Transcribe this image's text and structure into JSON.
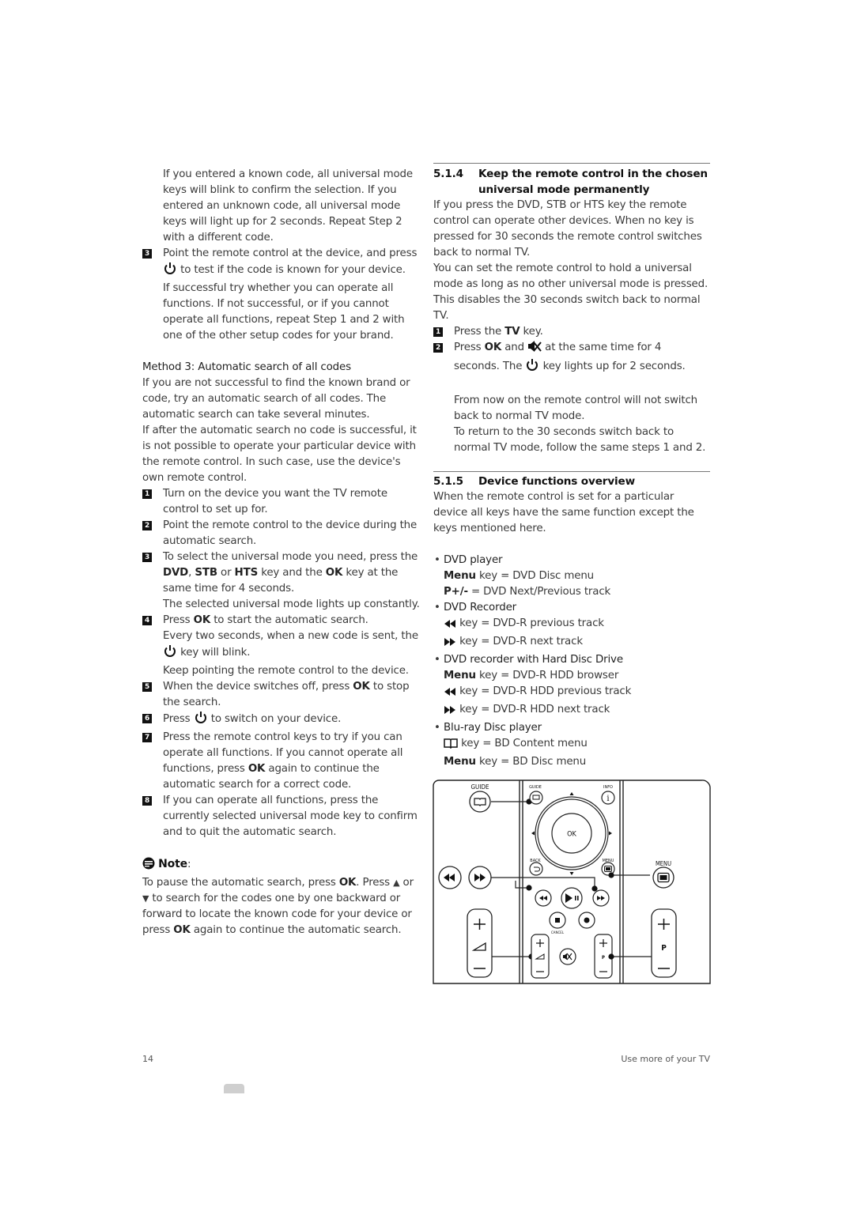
{
  "left": {
    "intro": "If you entered a known code, all universal mode keys will blink to confirm the selection. If you entered an unknown code, all universal mode keys will light up for 2 seconds. Repeat Step 2 with a different code.",
    "step3_num": "3",
    "step3_a": "Point the remote control at the device, and press",
    "step3_b": "to test if the code is known for your device.",
    "step3_c": "If successful try whether you can operate all functions. If not successful, or if you cannot operate all functions, repeat Step 1 and 2 with one of the other setup codes for your brand.",
    "method_title": "Method 3: Automatic search of all codes",
    "method_p1": "If you are not successful to find the known brand or code, try an automatic search of all codes. The automatic search can take several minutes.",
    "method_p2": "If after the automatic search no code is successful, it is not possible to operate your particular device with the remote control. In such case, use the device's own remote control.",
    "steps": [
      {
        "num": "1",
        "text": "Turn on the device you want the TV remote control to set up for."
      },
      {
        "num": "2",
        "text": "Point the remote control to the device during the automatic search."
      },
      {
        "num": "3",
        "t1": "To select the universal mode you need, press the",
        "k1": "DVD",
        "t2": ",",
        "k2": "STB",
        "t3": "or",
        "k3": "HTS",
        "t4": "key and the",
        "k4": "OK",
        "t5": "key at the same time for 4 seconds.",
        "t6": "The selected universal mode lights up constantly."
      },
      {
        "num": "4",
        "t1": "Press",
        "k1": "OK",
        "t2": "to start the automatic search.",
        "t3": "Every two seconds, when a new code is sent, the",
        "t4": "key will blink.",
        "t5": "Keep pointing the remote control to the device."
      },
      {
        "num": "5",
        "t1": "When the device switches off, press",
        "k1": "OK",
        "t2": "to stop the search."
      },
      {
        "num": "6",
        "t1": "Press",
        "t2": "to switch on your device."
      },
      {
        "num": "7",
        "t1": "Press the remote control keys to try if you can operate all functions. If you cannot operate all functions, press",
        "k1": "OK",
        "t2": "again to continue the automatic search for a correct code."
      },
      {
        "num": "8",
        "text": "If you can operate all functions, press the currently selected universal mode key to confirm and to quit the automatic search."
      }
    ],
    "note": {
      "title": "Note",
      "t1": "To pause the automatic search, press",
      "k1": "OK",
      "t2": ". Press",
      "t3": "or",
      "t4": "to search for the codes one by one backward or forward to locate the known code for your device or press",
      "k2": "OK",
      "t5": "again to continue the automatic search."
    }
  },
  "right": {
    "s514": {
      "num": "5.1.4",
      "title": "Keep the remote control in the chosen universal mode permanently",
      "p1": "If you press the DVD, STB or HTS key the remote control can operate other devices. When no key is pressed  for 30 seconds the remote control switches back to normal TV.",
      "p2": "You can set the remote control to hold a universal mode as long as no other universal mode is pressed. This disables the 30 seconds switch back to normal TV.",
      "step1": {
        "num": "1",
        "t1": "Press the",
        "k1": "TV",
        "t2": "key."
      },
      "step2": {
        "num": "2",
        "t1": "Press",
        "k1": "OK",
        "t2": "and",
        "t3": "at the same time for 4 seconds. The",
        "t4": "key lights up for 2 seconds."
      },
      "p3": "From now on the remote control will not switch back to normal TV mode.",
      "p4": "To return to the 30 seconds switch back to normal TV mode, follow the same steps 1 and 2."
    },
    "s515": {
      "num": "5.1.5",
      "title": "Device functions overview",
      "p1": "When the remote control is set for a particular device all keys have the same function except the keys mentioned here.",
      "devices": [
        {
          "name": "DVD player",
          "lines": [
            {
              "key": "Menu",
              "text": "key = DVD Disc menu"
            },
            {
              "key": "P+/-",
              "text": "= DVD Next/Previous track"
            }
          ]
        },
        {
          "name": "DVD Recorder",
          "lines": [
            {
              "icon": "rewind-icon",
              "text": "key = DVD-R previous track"
            },
            {
              "icon": "fast-forward-icon",
              "text": "key = DVD-R next track"
            }
          ]
        },
        {
          "name": "DVD recorder with Hard Disc Drive",
          "lines": [
            {
              "key": "Menu",
              "text": "key = DVD-R HDD browser"
            },
            {
              "icon": "rewind-icon",
              "text": "key = DVD-R HDD previous track"
            },
            {
              "icon": "fast-forward-icon",
              "text": "key = DVD-R HDD next track"
            }
          ]
        },
        {
          "name": "Blu-ray Disc player",
          "lines": [
            {
              "icon": "guide-book-icon",
              "text": "key = BD Content menu"
            },
            {
              "key": "Menu",
              "text": "key = BD Disc menu"
            }
          ]
        }
      ]
    },
    "remote": {
      "guide_label": "GUIDE",
      "guide_small_label": "GUIDE",
      "info_label": "INFO",
      "ok_label": "OK",
      "back_label": "BACK",
      "menu_small_label": "MENU",
      "menu_label": "MENU",
      "cancel_label": "CANCEL",
      "p_label": "P"
    }
  },
  "footer": {
    "page_number": "14",
    "section": "Use more of your TV"
  }
}
